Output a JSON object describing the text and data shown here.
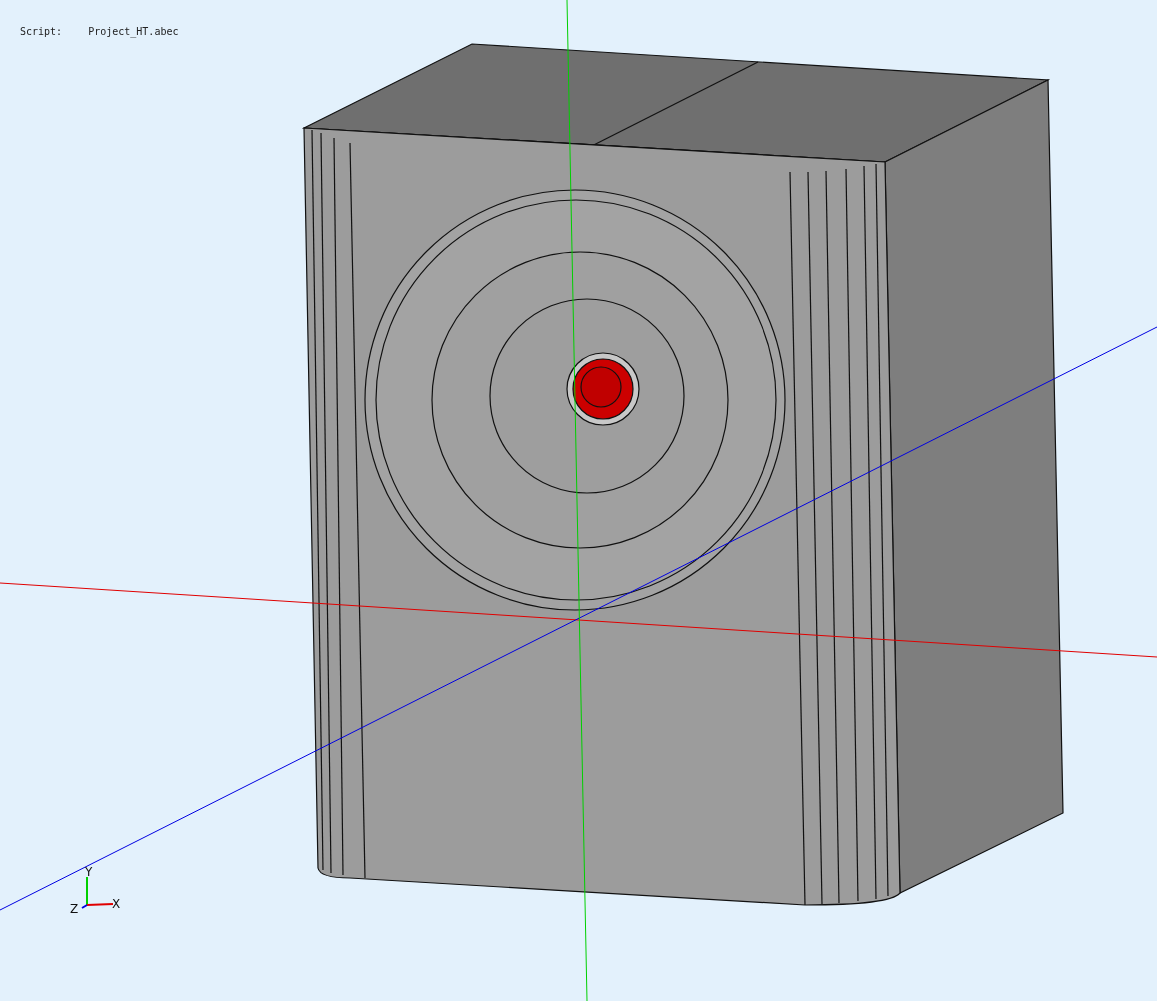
{
  "viewport": {
    "script_label": "Script:",
    "script_file": "Project_HT.abec"
  },
  "axis_triad": {
    "x_label": "X",
    "y_label": "Y",
    "z_label": "Z"
  }
}
